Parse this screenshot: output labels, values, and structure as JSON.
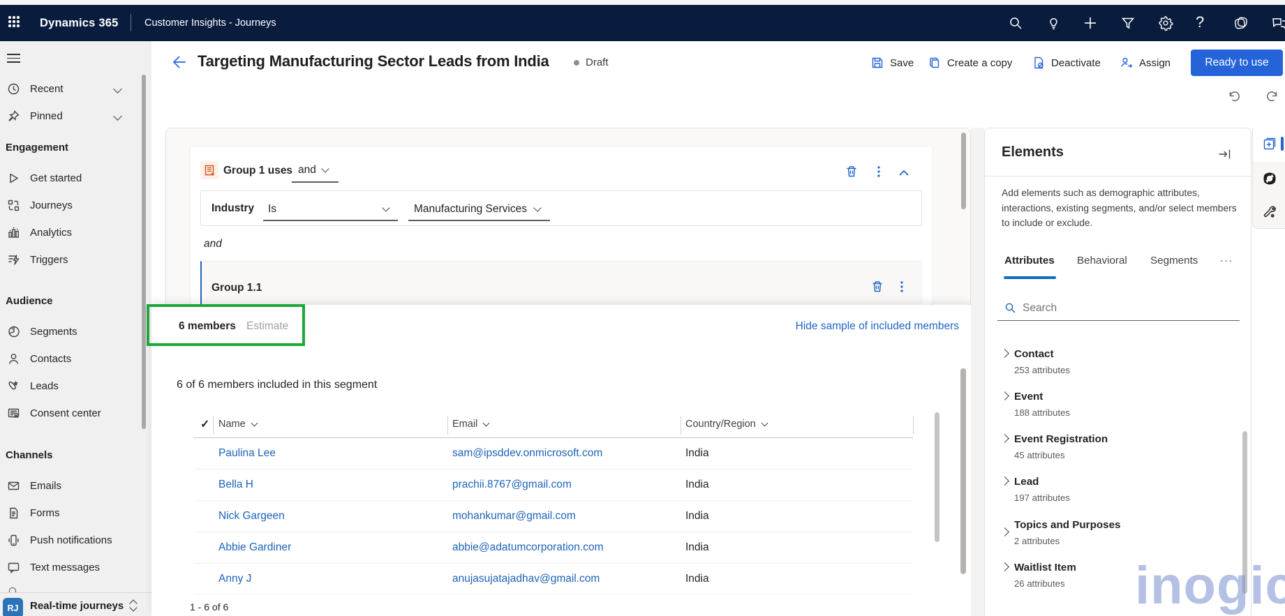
{
  "topbar": {
    "brand": "Dynamics 365",
    "app": "Customer Insights - Journeys",
    "icons": [
      "search-icon",
      "lightbulb-icon",
      "add-icon",
      "filter-icon",
      "settings-icon",
      "help-icon",
      "copilot-icon",
      "chat-icon"
    ]
  },
  "sidebar": {
    "groups": [
      {
        "heading": "",
        "items": [
          {
            "label": "Recent",
            "icon": "clock"
          },
          {
            "label": "Pinned",
            "icon": "pin"
          }
        ]
      },
      {
        "heading": "Engagement",
        "items": [
          {
            "label": "Get started",
            "icon": "play"
          },
          {
            "label": "Journeys",
            "icon": "journeys"
          },
          {
            "label": "Analytics",
            "icon": "analytics"
          },
          {
            "label": "Triggers",
            "icon": "triggers"
          }
        ]
      },
      {
        "heading": "Audience",
        "items": [
          {
            "label": "Segments",
            "icon": "segments"
          },
          {
            "label": "Contacts",
            "icon": "contacts"
          },
          {
            "label": "Leads",
            "icon": "leads"
          },
          {
            "label": "Consent center",
            "icon": "consent"
          }
        ]
      },
      {
        "heading": "Channels",
        "items": [
          {
            "label": "Emails",
            "icon": "email"
          },
          {
            "label": "Forms",
            "icon": "forms"
          },
          {
            "label": "Push notifications",
            "icon": "push"
          },
          {
            "label": "Text messages",
            "icon": "sms"
          }
        ]
      }
    ],
    "area_switcher": {
      "badge": "RJ",
      "label": "Real-time journeys"
    }
  },
  "header": {
    "title": "Targeting Manufacturing Sector Leads from India",
    "status": "Draft",
    "commands": {
      "save": "Save",
      "copy": "Create a copy",
      "deactivate": "Deactivate",
      "assign": "Assign"
    },
    "primary_action": "Ready to use"
  },
  "builder": {
    "group_title": "Group 1 uses",
    "group_operator": "and",
    "condition": {
      "field": "Industry",
      "operator": "Is",
      "value": "Manufacturing Services"
    },
    "connector": "and",
    "subgroup_title": "Group 1.1"
  },
  "members_panel": {
    "members_tab": "6 members",
    "estimate_tab": "Estimate",
    "hide_link": "Hide sample of included members",
    "summary": "6 of 6 members included in this segment",
    "table": {
      "columns": [
        "Name",
        "Email",
        "Country/Region"
      ],
      "rows": [
        [
          "Paulina Lee",
          "sam@ipsddev.onmicrosoft.com",
          "India"
        ],
        [
          "Bella H",
          "prachii.8767@gmail.com",
          "India"
        ],
        [
          "Nick Gargeen",
          "mohankumar@gmail.com",
          "India"
        ],
        [
          "Abbie Gardiner",
          "abbie@adatumcorporation.com",
          "India"
        ],
        [
          "Anny J",
          "anujasujatajadhav@gmail.com",
          "India"
        ]
      ],
      "pagination": "1 - 6 of 6"
    }
  },
  "elements_panel": {
    "title": "Elements",
    "description": "Add elements such as demographic attributes, interactions, existing segments, and/or select members to include or exclude.",
    "tabs": {
      "attributes": "Attributes",
      "behavioral": "Behavioral",
      "segments": "Segments",
      "more": "···"
    },
    "search_placeholder": "Search",
    "items": [
      {
        "name": "Contact",
        "count": "253 attributes"
      },
      {
        "name": "Event",
        "count": "188 attributes"
      },
      {
        "name": "Event Registration",
        "count": "45 attributes"
      },
      {
        "name": "Lead",
        "count": "197 attributes"
      },
      {
        "name": "Topics and Purposes",
        "count": "2 attributes"
      },
      {
        "name": "Waitlist Item",
        "count": "26 attributes"
      }
    ]
  },
  "watermark": "inogic",
  "colors": {
    "accent_blue": "#2464d8",
    "link_blue": "#2065c8",
    "annotation_green": "#1fa63c",
    "topbar_navy": "#0a1c3e"
  }
}
